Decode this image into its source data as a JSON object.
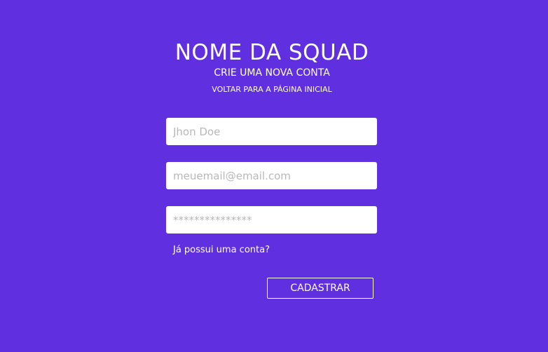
{
  "header": {
    "title": "NOME DA SQUAD",
    "subtitle": "CRIE UMA NOVA CONTA",
    "back_link": "VOLTAR PARA A PÁGINA INICIAL"
  },
  "form": {
    "name_placeholder": "Jhon Doe",
    "email_placeholder": "meuemail@email.com",
    "password_placeholder": "***************",
    "login_link": "Já possui uma conta?",
    "submit_label": "CADASTRAR"
  },
  "colors": {
    "background": "#5f2fe0",
    "text": "#ffffff",
    "field_background": "#ffffff",
    "placeholder": "#b8b8b8"
  }
}
